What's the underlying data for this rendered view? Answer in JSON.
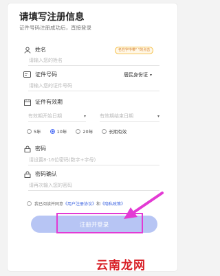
{
  "page": {
    "title": "请填写注册信息",
    "subtitle": "证件号码注册成功后，直接登录"
  },
  "name": {
    "label": "姓名",
    "placeholder": "请输入您的姓名",
    "hint": "名在字中带\" \"的点击"
  },
  "id_number": {
    "label": "证件号码",
    "type_value": "居民身份证",
    "placeholder": "请输入您的证件号码"
  },
  "validity": {
    "label": "证件有效期",
    "start_placeholder": "有效期开始日期",
    "end_placeholder": "有效期结束日期",
    "options": [
      {
        "label": "5年",
        "selected": false
      },
      {
        "label": "10年",
        "selected": true
      },
      {
        "label": "20年",
        "selected": false
      },
      {
        "label": "长期有效",
        "selected": false
      }
    ]
  },
  "password": {
    "label": "密码",
    "placeholder": "请设置8-16位密码(数字+字母)"
  },
  "password_confirm": {
    "label": "密码确认",
    "placeholder": "请再次输入您的密码"
  },
  "agreement": {
    "prefix": "我已阅读并同意",
    "link1": "《用户注册协议》",
    "and": "和",
    "link2": "《隐私政策》"
  },
  "submit": {
    "label": "注册并登录"
  },
  "watermark": {
    "text": "云南龙网"
  },
  "colors": {
    "accent": "#4a6cf7",
    "button_bg": "#b7c5f4",
    "annotation": "#e33ad4",
    "watermark": "#d81f26"
  }
}
